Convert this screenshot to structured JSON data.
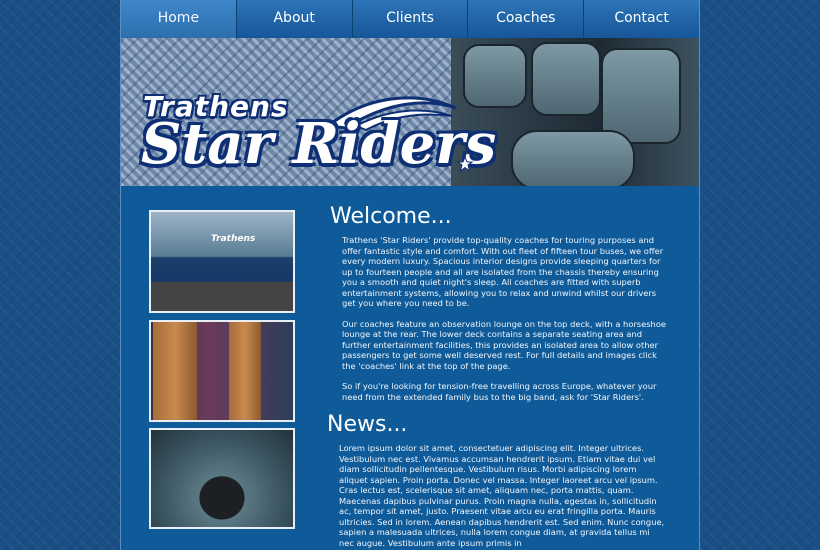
{
  "nav": {
    "items": [
      {
        "label": "Home",
        "active": true
      },
      {
        "label": "About",
        "active": false
      },
      {
        "label": "Clients",
        "active": false
      },
      {
        "label": "Coaches",
        "active": false
      },
      {
        "label": "Contact",
        "active": false
      }
    ]
  },
  "banner": {
    "logo_top": "Trathens",
    "logo_main": "Star Riders"
  },
  "main": {
    "welcome_title": "Welcome...",
    "paragraphs": [
      "Trathens 'Star Riders' provide top-quality coaches for touring purposes and offer fantastic style and comfort. With out fleet of fifteen tour buses, we offer every modern luxury. Spacious interior designs provide sleeping quarters for up to fourteen people and all are isolated from the chassis thereby ensuring you a smooth and quiet night's sleep. All coaches are fitted with superb entertainment systems, allowing you to relax and unwind whilst our drivers get you where you need to be.",
      "Our coaches feature an observation lounge on the top deck, with a horseshoe lounge at the rear. The lower deck contains a separate seating area and further entertainment facilities, this provides an isolated area to allow other passengers to get some well deserved rest. For full details and images click the 'coaches' link at the top of the page.",
      "So if you're looking for tension-free travelling across Europe, whatever your need from the extended family bus to the big band, ask for 'Star Riders'."
    ],
    "news_title": "News...",
    "news_text": "Lorem ipsum dolor sit amet, consectetuer adipiscing elit. Integer ultrices. Vestibulum nec est. Vivamus accumsan hendrerit ipsum. Etiam vitae dui vel diam sollicitudin pellentesque. Vestibulum risus. Morbi adipiscing lorem aliquet sapien. Proin porta. Donec vel massa. Integer laoreet arcu vel ipsum. Cras lectus est, scelerisque sit amet, aliquam nec, porta mattis, quam. Maecenas dapibus pulvinar purus. Proin magna nulla, egestas in, sollicitudin ac, tempor sit amet, justo. Praesent vitae arcu eu erat fringilla porta. Mauris ultricies. Sed in lorem. Aenean dapibus hendrerit est. Sed enim. Nunc congue, sapien a malesuada ultrices, nulla lorem congue diam, at gravida tellus mi nec augue. Vestibulum ante ipsum primis in"
  },
  "bus_lettering": "Trathens",
  "colors": {
    "page_background": "#1a4f86",
    "content_background": "#0f5b9a",
    "nav_gradient_top": "#2d74b6",
    "nav_gradient_bottom": "#16579a",
    "logo_outline": "#0e2f74"
  }
}
